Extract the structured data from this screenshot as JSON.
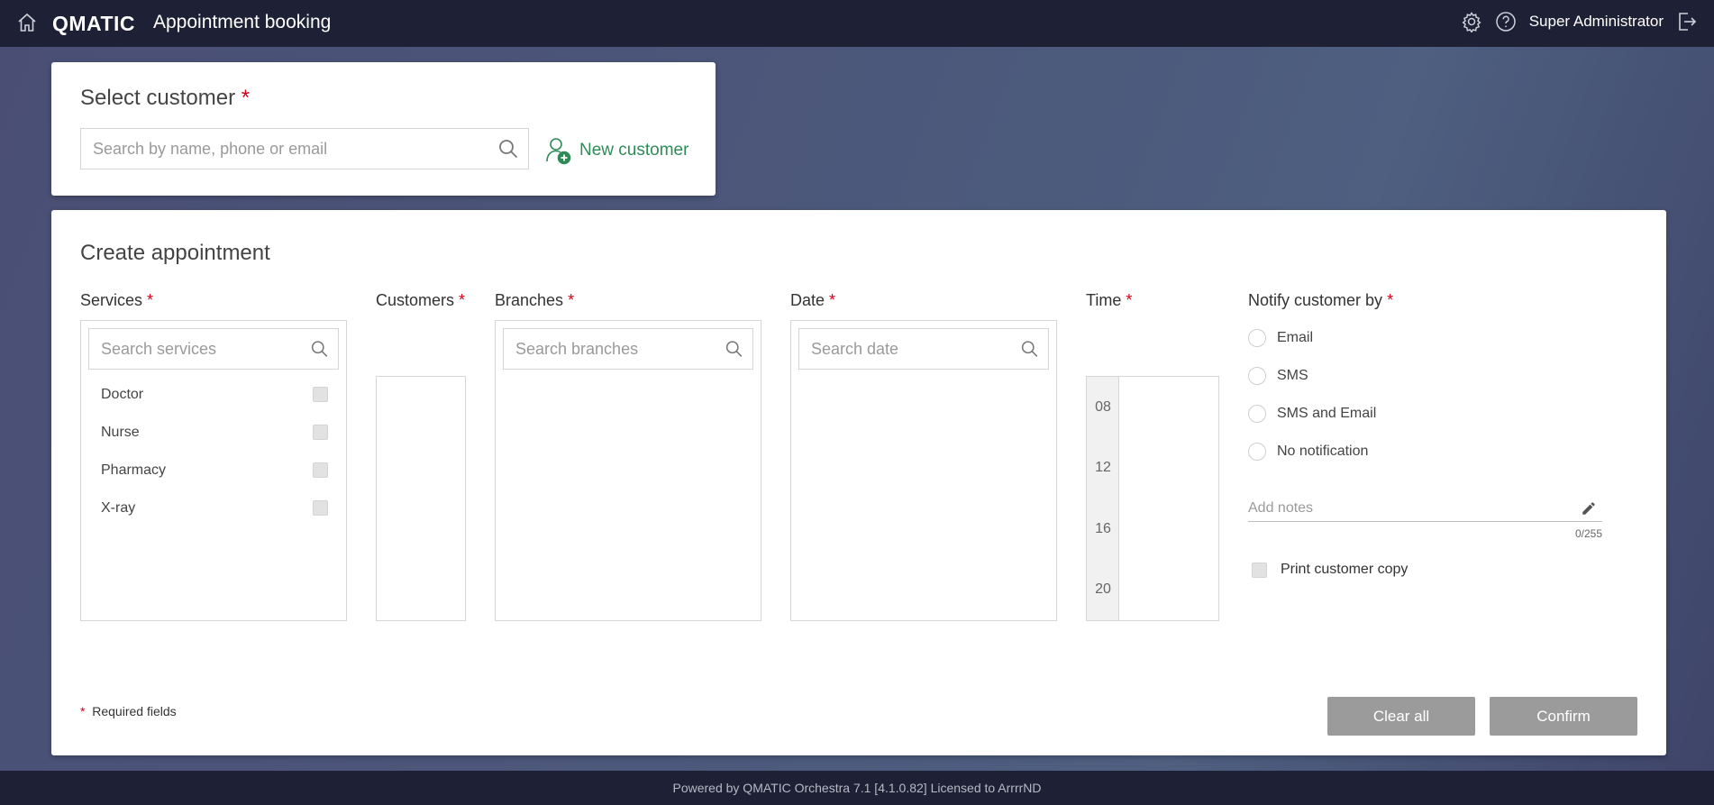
{
  "header": {
    "brand": "QMATIC",
    "app_title": "Appointment booking",
    "user_name": "Super Administrator"
  },
  "customer_card": {
    "title": "Select customer",
    "required_mark": "*",
    "search_placeholder": "Search by name, phone or email",
    "new_customer_label": "New customer"
  },
  "appointment_card": {
    "title": "Create appointment",
    "columns": {
      "services": "Services",
      "customers": "Customers",
      "branches": "Branches",
      "date": "Date",
      "time": "Time",
      "notify": "Notify customer by"
    },
    "services_search_placeholder": "Search services",
    "services": [
      "Doctor",
      "Nurse",
      "Pharmacy",
      "X-ray"
    ],
    "branches_search_placeholder": "Search branches",
    "date_search_placeholder": "Search date",
    "time_labels": [
      "08",
      "12",
      "16",
      "20"
    ],
    "notify_options": [
      "Email",
      "SMS",
      "SMS and Email",
      "No notification"
    ],
    "notes_placeholder": "Add notes",
    "notes_counter": "0/255",
    "print_copy_label": "Print customer copy",
    "required_fields_note": "Required fields",
    "clear_all_label": "Clear all",
    "confirm_label": "Confirm"
  },
  "footer": {
    "text": "Powered by QMATIC Orchestra 7.1 [4.1.0.82] Licensed to ArrrrND"
  },
  "colors": {
    "header_bg": "#1e2036",
    "accent_green": "#2e8b57",
    "required_red": "#d0021b",
    "button_gray": "#9b9b9b"
  }
}
